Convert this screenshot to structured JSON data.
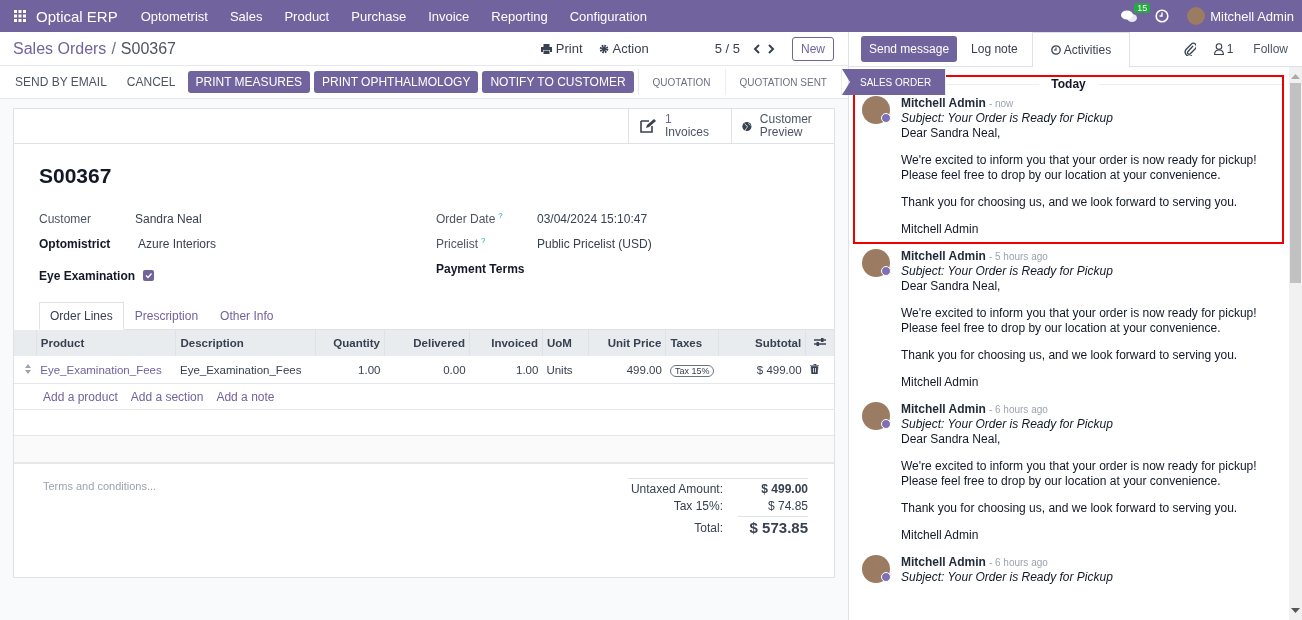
{
  "navbar": {
    "app_name": "Optical ERP",
    "menu": [
      "Optometrist",
      "Sales",
      "Product",
      "Purchase",
      "Invoice",
      "Reporting",
      "Configuration"
    ],
    "message_count": "15",
    "user": "Mitchell Admin"
  },
  "control_panel": {
    "breadcrumb_parent": "Sales Orders",
    "breadcrumb_separator": "/",
    "breadcrumb_current": "S00367",
    "print": "Print",
    "action": "Action",
    "pager": "5 / 5",
    "new_button": "New"
  },
  "status_bar": {
    "buttons": [
      {
        "label": "SEND BY EMAIL",
        "kind": "secondary"
      },
      {
        "label": "CANCEL",
        "kind": "secondary"
      },
      {
        "label": "PRINT MEASURES",
        "kind": "primary"
      },
      {
        "label": "PRINT OPHTHALMOLOGY",
        "kind": "primary"
      },
      {
        "label": "NOTIFY TO CUSTOMER",
        "kind": "primary"
      }
    ],
    "stages": [
      {
        "label": "QUOTATION",
        "selected": false
      },
      {
        "label": "QUOTATION SENT",
        "selected": false
      },
      {
        "label": "SALES ORDER",
        "selected": true
      }
    ]
  },
  "form": {
    "smart_buttons": [
      {
        "kind": "invoices",
        "count": "1",
        "label": "Invoices"
      },
      {
        "kind": "preview",
        "label": "Customer Preview"
      }
    ],
    "title": "S00367",
    "fields_left": [
      {
        "kind": "text",
        "label": "Customer",
        "value": "Sandra Neal",
        "required": false
      },
      {
        "kind": "text",
        "label": "Optomistrict",
        "value": "Azure Interiors",
        "required": true
      },
      {
        "kind": "checkbox",
        "label": "Eye Examination",
        "checked": true,
        "required": true
      }
    ],
    "fields_right": [
      {
        "kind": "text",
        "label": "Order Date",
        "help": "?",
        "value": "03/04/2024 15:10:47",
        "required": false
      },
      {
        "kind": "text",
        "label": "Pricelist",
        "help": "?",
        "value": "Public Pricelist (USD)",
        "required": false
      },
      {
        "label": "Payment Terms",
        "required": true
      }
    ],
    "tabs": [
      {
        "label": "Order Lines",
        "selected": true
      },
      {
        "label": "Prescription",
        "selected": false
      },
      {
        "label": "Other Info",
        "selected": false
      }
    ],
    "order_lines": {
      "columns": [
        {
          "label": "Product",
          "kind": "link"
        },
        {
          "label": "Description",
          "kind": "text"
        },
        {
          "label": "Quantity",
          "kind": "number"
        },
        {
          "label": "Delivered",
          "kind": "number"
        },
        {
          "label": "Invoiced",
          "kind": "number"
        },
        {
          "label": "UoM",
          "kind": "text"
        },
        {
          "label": "Unit Price",
          "kind": "number"
        },
        {
          "label": "Taxes",
          "kind": "tags"
        },
        {
          "label": "Subtotal",
          "kind": "number"
        }
      ],
      "rows": [
        {
          "cells": [
            "Eye_Examination_Fees",
            "Eye_Examination_Fees",
            "1.00",
            "0.00",
            "1.00",
            "Units",
            "499.00",
            [
              "Tax 15%"
            ],
            "$ 499.00"
          ]
        }
      ],
      "add_links": [
        "Add a product",
        "Add a section",
        "Add a note"
      ]
    },
    "terms_placeholder": "Terms and conditions...",
    "totals": [
      {
        "kind": "untaxed",
        "label": "Untaxed Amount:",
        "value": "$ 499.00"
      },
      {
        "kind": "tax",
        "label": "Tax 15%:",
        "value": "$ 74.85"
      },
      {
        "kind": "total",
        "label": "Total:",
        "value": "$ 573.85"
      }
    ]
  },
  "chatter": {
    "send_message": "Send message",
    "log_note": "Log note",
    "activities": "Activities",
    "followers": "1",
    "follow": "Follow",
    "date_separator": "Today",
    "messages": [
      {
        "author": "Mitchell Admin",
        "time": "- now",
        "highlighted": true,
        "subject": "Subject: Your Order is Ready for Pickup",
        "body": [
          "Dear Sandra Neal,",
          "We're excited to inform you that your order is now ready for pickup! Please feel free to drop by our location at your convenience.",
          "Thank you for choosing us, and we look forward to serving you.",
          "Mitchell Admin"
        ]
      },
      {
        "author": "Mitchell Admin",
        "time": "- 5 hours ago",
        "highlighted": false,
        "subject": "Subject: Your Order is Ready for Pickup",
        "body": [
          "Dear Sandra Neal,",
          "We're excited to inform you that your order is now ready for pickup! Please feel free to drop by our location at your convenience.",
          "Thank you for choosing us, and we look forward to serving you.",
          "Mitchell Admin"
        ]
      },
      {
        "author": "Mitchell Admin",
        "time": "- 6 hours ago",
        "highlighted": false,
        "subject": "Subject: Your Order is Ready for Pickup",
        "body": [
          "Dear Sandra Neal,",
          "We're excited to inform you that your order is now ready for pickup! Please feel free to drop by our location at your convenience.",
          "Thank you for choosing us, and we look forward to serving you.",
          "Mitchell Admin"
        ]
      },
      {
        "author": "Mitchell Admin",
        "time": "- 6 hours ago",
        "highlighted": false,
        "subject": "Subject: Your Order is Ready for Pickup"
      }
    ]
  }
}
